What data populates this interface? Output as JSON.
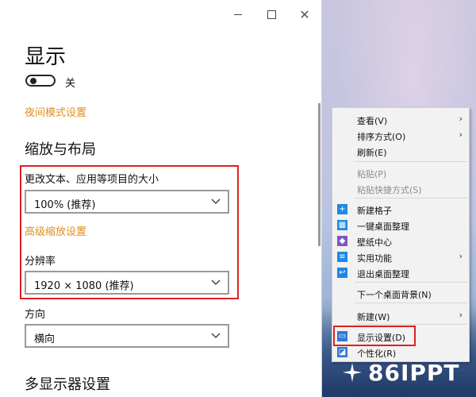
{
  "window": {
    "controls": {
      "minimize": "minimize",
      "maximize": "maximize",
      "close": "✕"
    },
    "page_title": "显示",
    "night_light": {
      "state_label": "关",
      "enabled": false
    },
    "night_link": "夜间模式设置",
    "scale_section": "缩放与布局",
    "scale_label": "更改文本、应用等项目的大小",
    "scale_value": "100% (推荐)",
    "advanced_scaling_link": "高级缩放设置",
    "resolution_label": "分辨率",
    "resolution_value": "1920 × 1080 (推荐)",
    "orientation_label": "方向",
    "orientation_value": "横向",
    "multi_display_section": "多显示器设置"
  },
  "context_menu": {
    "items": [
      {
        "label": "查看(V)",
        "submenu": true
      },
      {
        "label": "排序方式(O)",
        "submenu": true
      },
      {
        "label": "刷新(E)"
      },
      {
        "label": "粘贴(P)",
        "disabled": true
      },
      {
        "label": "粘贴快捷方式(S)",
        "disabled": true
      },
      {
        "label": "新建格子",
        "icon": "plus-icon",
        "icon_color": "#1e88e5"
      },
      {
        "label": "一键桌面整理",
        "icon": "grid-icon",
        "icon_color": "#1e88e5"
      },
      {
        "label": "壁纸中心",
        "icon": "cube-icon",
        "icon_color": "#7e57c2"
      },
      {
        "label": "实用功能",
        "icon": "list-icon",
        "icon_color": "#1e88e5",
        "submenu": true
      },
      {
        "label": "退出桌面整理",
        "icon": "exit-icon",
        "icon_color": "#1e88e5"
      },
      {
        "label": "下一个桌面背景(N)"
      },
      {
        "label": "新建(W)",
        "submenu": true
      },
      {
        "label": "显示设置(D)",
        "icon": "monitor-icon",
        "icon_color": "#2d7bd6"
      },
      {
        "label": "个性化(R)",
        "icon": "personalize-icon",
        "icon_color": "#2d7bd6"
      }
    ],
    "submenu_arrow": "›"
  },
  "colors": {
    "accent_link": "#e08f1a",
    "highlight_box": "#e02020"
  },
  "watermark": {
    "text": "86IPPT",
    "icon": "sparkle-icon"
  }
}
